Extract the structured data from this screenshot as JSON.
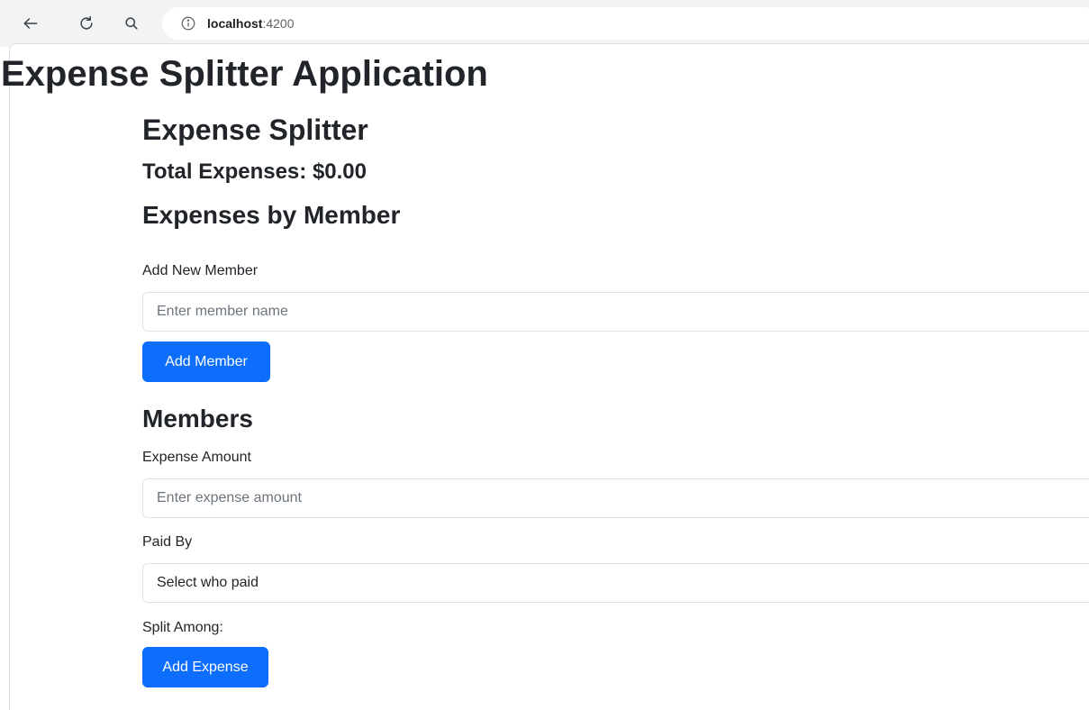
{
  "browser": {
    "url_host": "localhost",
    "url_port": ":4200",
    "back_icon": "back-arrow-icon",
    "reload_icon": "reload-icon",
    "search_icon": "search-icon",
    "info_icon": "info-icon"
  },
  "page": {
    "app_title": "Expense Splitter Application",
    "splitter_title": "Expense Splitter",
    "total_expenses": "Total Expenses: $0.00",
    "expenses_by_member": "Expenses by Member",
    "members_heading": "Members"
  },
  "add_member": {
    "label": "Add New Member",
    "placeholder": "Enter member name",
    "value": "",
    "button_label": "Add Member"
  },
  "add_expense": {
    "amount_label": "Expense Amount",
    "amount_placeholder": "Enter expense amount",
    "amount_value": "",
    "paid_by_label": "Paid By",
    "paid_by_selected": "Select who paid",
    "split_among_label": "Split Among:",
    "button_label": "Add Expense"
  },
  "colors": {
    "primary": "#0d6efd",
    "text": "#212529",
    "border": "#dee2e6"
  }
}
